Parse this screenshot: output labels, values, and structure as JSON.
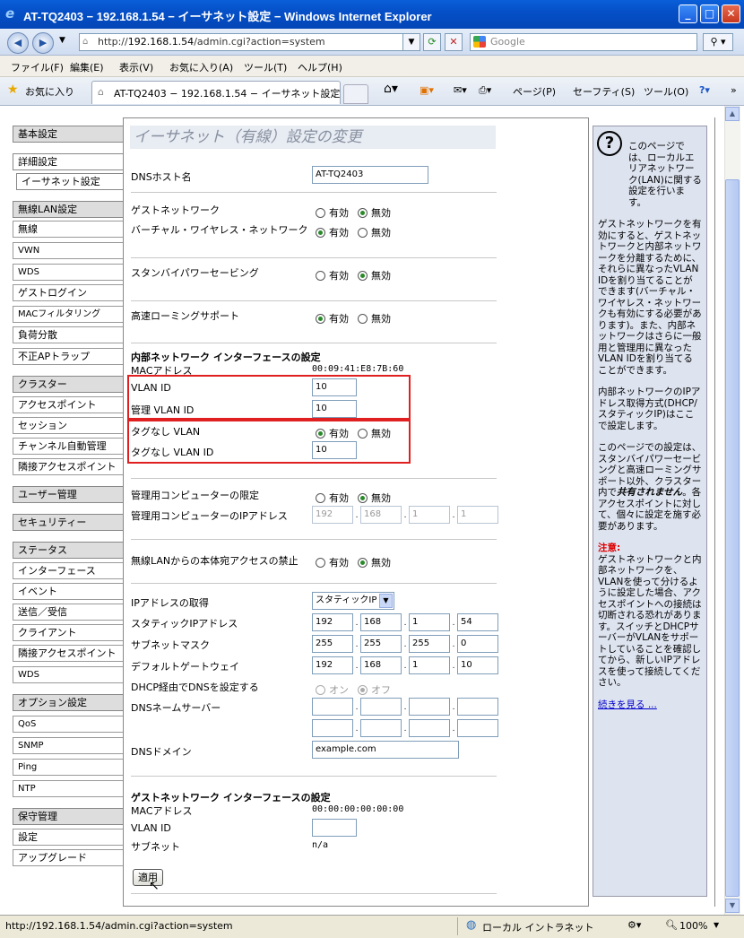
{
  "window": {
    "title": "AT-TQ2403 − 192.168.1.54 − イーサネット設定 − Windows Internet Explorer",
    "min": "_",
    "max": "□",
    "close": "✕"
  },
  "address": {
    "url_prefix": "http://",
    "url_host": "192.168.1.54",
    "url_path": "/admin.cgi?action=system",
    "search_placeholder": "Google"
  },
  "menubar": [
    "ファイル(F)",
    "編集(E)",
    "表示(V)",
    "お気に入り(A)",
    "ツール(T)",
    "ヘルプ(H)"
  ],
  "favbar": {
    "favorites": "お気に入り",
    "tab_title": "AT-TQ2403 − 192.168.1.54 − イーサネット設定",
    "page": "ページ(P)",
    "safety": "セーフティ(S)",
    "tools": "ツール(O)"
  },
  "nav": [
    {
      "label": "基本設定",
      "kind": "sec"
    },
    {
      "label": "詳細設定",
      "kind": "act"
    },
    {
      "label": "イーサネット設定",
      "kind": "act"
    },
    {
      "label": "無線LAN設定",
      "kind": "sec"
    },
    {
      "label": "無線",
      "kind": "item"
    },
    {
      "label": "VWN",
      "kind": "small"
    },
    {
      "label": "WDS",
      "kind": "small"
    },
    {
      "label": "ゲストログイン",
      "kind": "item"
    },
    {
      "label": "MACフィルタリング",
      "kind": "small"
    },
    {
      "label": "負荷分散",
      "kind": "item"
    },
    {
      "label": "不正APトラップ",
      "kind": "item"
    },
    {
      "label": "クラスター",
      "kind": "sec"
    },
    {
      "label": "アクセスポイント",
      "kind": "item"
    },
    {
      "label": "セッション",
      "kind": "item"
    },
    {
      "label": "チャンネル自動管理",
      "kind": "item"
    },
    {
      "label": "隣接アクセスポイント",
      "kind": "item"
    },
    {
      "label": "ユーザー管理",
      "kind": "sec"
    },
    {
      "label": "セキュリティー",
      "kind": "sec"
    },
    {
      "label": "ステータス",
      "kind": "sec"
    },
    {
      "label": "インターフェース",
      "kind": "item"
    },
    {
      "label": "イベント",
      "kind": "item"
    },
    {
      "label": "送信／受信",
      "kind": "item"
    },
    {
      "label": "クライアント",
      "kind": "item"
    },
    {
      "label": "隣接アクセスポイント",
      "kind": "item"
    },
    {
      "label": "WDS",
      "kind": "small"
    },
    {
      "label": "オプション設定",
      "kind": "sec"
    },
    {
      "label": "QoS",
      "kind": "small"
    },
    {
      "label": "SNMP",
      "kind": "small"
    },
    {
      "label": "Ping",
      "kind": "small"
    },
    {
      "label": "NTP",
      "kind": "small"
    },
    {
      "label": "保守管理",
      "kind": "sec"
    },
    {
      "label": "設定",
      "kind": "item"
    },
    {
      "label": "アップグレード",
      "kind": "item"
    }
  ],
  "main": {
    "heading": "イーサネット（有線）設定の変更",
    "dns_host_label": "DNSホスト名",
    "dns_host_value": "AT-TQ2403",
    "guest_network_label": "ゲストネットワーク",
    "virtual_wireless_label": "バーチャル・ワイヤレス・ネットワーク",
    "standby_label": "スタンバイパワーセービング",
    "fast_roaming_label": "高速ローミングサポート",
    "opt_on": "有効",
    "opt_off": "無効",
    "internal_header": "内部ネットワーク インターフェースの設定",
    "mac_label": "MACアドレス",
    "mac_value": "00:09:41:E8:7B:60",
    "vlan_id_label": "VLAN ID",
    "vlan_id_value": "10",
    "mgmt_vlan_label": "管理 VLAN ID",
    "mgmt_vlan_value": "10",
    "untagged_label": "タグなし VLAN",
    "untagged_id_label": "タグなし VLAN ID",
    "untagged_id_value": "10",
    "mgmt_pc_limit_label": "管理用コンピューターの限定",
    "mgmt_pc_ip_label": "管理用コンピューターのIPアドレス",
    "mgmt_pc_ip": [
      "192",
      "168",
      "1",
      "1"
    ],
    "wlan_block_label": "無線LANからの本体宛アクセスの禁止",
    "ip_acq_label": "IPアドレスの取得",
    "ip_acq_value": "スタティックIP",
    "static_ip_label": "スタティックIPアドレス",
    "static_ip": [
      "192",
      "168",
      "1",
      "54"
    ],
    "subnet_label": "サブネットマスク",
    "subnet": [
      "255",
      "255",
      "255",
      "0"
    ],
    "gateway_label": "デフォルトゲートウェイ",
    "gateway": [
      "192",
      "168",
      "1",
      "10"
    ],
    "dhcp_dns_label": "DHCP経由でDNSを設定する",
    "dhcp_on": "オン",
    "dhcp_off": "オフ",
    "dns_servers_label": "DNSネームサーバー",
    "dns_domain_label": "DNSドメイン",
    "dns_domain_value": "example.com",
    "guest_header": "ゲストネットワーク インターフェースの設定",
    "guest_mac_label": "MACアドレス",
    "guest_mac_value": "00:00:00:00:00:00",
    "guest_vlan_label": "VLAN ID",
    "guest_subnet_label": "サブネット",
    "guest_subnet_value": "n/a",
    "apply": "適用",
    "radios": {
      "guest_network": "off",
      "virtual_wireless": "on",
      "standby": "off",
      "fast_roaming": "on",
      "untagged_vlan": "on",
      "mgmt_pc_limit": "off",
      "wlan_block": "off",
      "dhcp_dns": "off"
    }
  },
  "help": {
    "icon": "?",
    "p1": "このページでは、ローカルエリアネットワーク(LAN)に関する設定を行います。",
    "p2": "ゲストネットワークを有効にすると、ゲストネットワークと内部ネットワークを分離するために、それらに異なったVLAN IDを割り当てることができます(バーチャル・ワイヤレス・ネットワークも有効にする必要があります)。また、内部ネットワークはさらに一般用と管理用に異なったVLAN IDを割り当てることができます。",
    "p3": "内部ネットワークのIPアドレス取得方式(DHCP/スタティックIP)はここで設定します。",
    "p4a": "このページでの設定は、スタンバイパワーセービングと高速ローミングサポート以外、クラスター内で",
    "p4b": "共有されません",
    "p4c": "。各アクセスポイントに対して、個々に設定を施す必要があります。",
    "note_title": "注意:",
    "note": "ゲストネットワークと内部ネットワークを、VLANを使って分けるように設定した場合、アクセスポイントへの接続は切断される恐れがあります。スイッチとDHCPサーバーがVLANをサポートしていることを確認してから、新しいIPアドレスを使って接続してください。",
    "more": "続きを見る ..."
  },
  "status": {
    "url": "http://192.168.1.54/admin.cgi?action=system",
    "zone": "ローカル イントラネット",
    "zoom": "100%"
  }
}
